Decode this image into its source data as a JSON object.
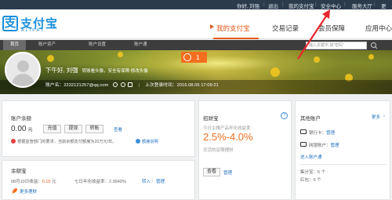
{
  "topbar": {
    "greeting": "你好,",
    "user": "刘强",
    "logout": "退出",
    "my_alipay": "我的支付宝",
    "security_center": "安全中心",
    "service_hall": "服务大厅",
    "more": "更"
  },
  "logo": {
    "mark": "支",
    "cn": "支付宝",
    "en": "ALIPAY"
  },
  "main_nav": [
    "我的支付宝",
    "交易记录",
    "会员保障",
    "应用中心"
  ],
  "sub_nav": [
    "首页",
    "账户资产",
    "账户设置",
    "账户通"
  ],
  "search_placeholder": "输入关键字,如\"密码\"",
  "banner": {
    "greeting": "下午好, 刘强",
    "tips": "转账看头像，安全有保障 修改头像",
    "account_label": "账户名：",
    "account_value": "2232121257@qq.com",
    "last_login_label": "上次登录时间：",
    "last_login_value": "2016.08.05 17:09:21",
    "notification_count": "1"
  },
  "balance": {
    "title": "账户余额",
    "amount": "0.00",
    "unit": "元",
    "recharge": "充值",
    "withdraw": "提现",
    "transfer": "转账",
    "view": "查看",
    "notice": "根据监管部门的要求，当前余额支付额度为20万元/年。",
    "quota_link": "额度说明"
  },
  "yuebao": {
    "title": "余额宝",
    "income_label": "08月10日收益：",
    "income_value": "0.15",
    "income_unit": "元",
    "rate_label": "七日年化收益率：",
    "rate_value": "2.3640%",
    "transfer_in": "转入",
    "manage": "管理",
    "more_tips": "更多理财"
  },
  "zhaocaibao": {
    "title": "招财宝",
    "subtitle": "今日主推产品年化收益率:",
    "rate": "2.5%-4.0%",
    "desc": "灵活的定期理财",
    "view": "查看",
    "manage": "管理",
    "help": "?"
  },
  "other_accounts": {
    "title": "其他账户",
    "more": "更多",
    "bank_card_label": "银行卡：",
    "bank_card_manage": "管理",
    "netbank_label": "网银账户：",
    "netbank_manage": "管理",
    "enter_account": "进入账户通",
    "points_label": "集分宝：",
    "points_value": "5 个",
    "red_packet_label": "红包：",
    "red_packet_value": "0 个"
  },
  "colors": {
    "brand_blue": "#1a8fdd",
    "accent_orange": "#e35a1f",
    "link_blue": "#1f6fbf",
    "arrow_red": "#e8262c"
  }
}
